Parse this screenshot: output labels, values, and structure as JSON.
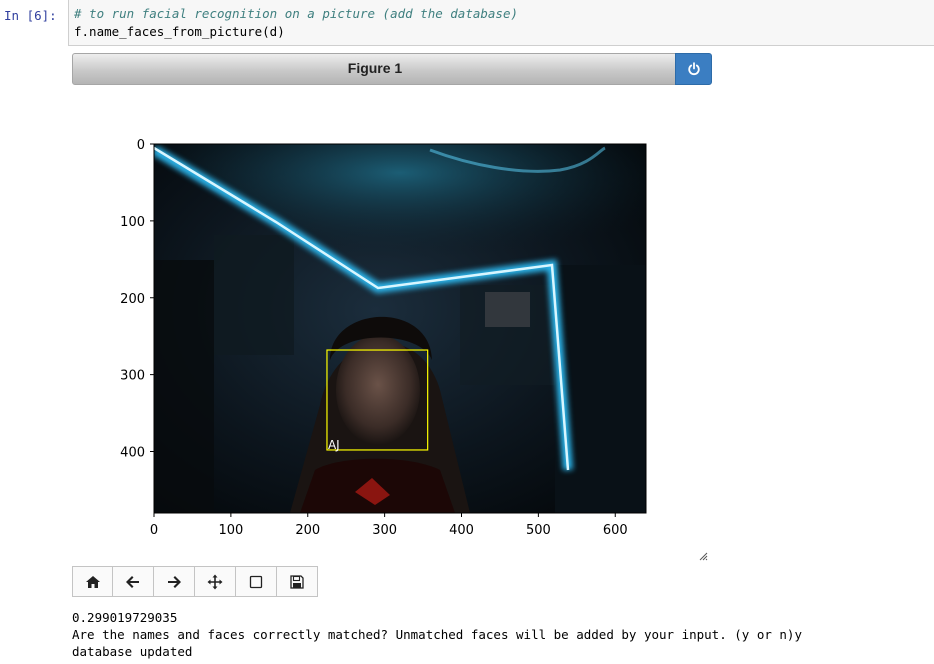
{
  "cell": {
    "prompt": "In [6]:",
    "code_comment": "# to run facial recognition on a picture (add the database)",
    "code_call": "f.name_faces_from_picture(d)"
  },
  "figure": {
    "title": "Figure 1",
    "power_icon": "power-icon"
  },
  "chart_data": {
    "type": "image",
    "x_ticks": [
      "0",
      "100",
      "200",
      "300",
      "400",
      "500",
      "600"
    ],
    "y_ticks": [
      "0",
      "100",
      "200",
      "300",
      "400"
    ],
    "xlim": [
      0,
      640
    ],
    "ylim": [
      480,
      0
    ],
    "face_box": {
      "label": "AJ",
      "x0": 225,
      "y0": 268,
      "x1": 356,
      "y1": 398,
      "color": "#ffff00"
    }
  },
  "toolbar": {
    "buttons": [
      "home-icon",
      "back-arrow-icon",
      "forward-arrow-icon",
      "move-icon",
      "zoom-rect-icon",
      "save-icon"
    ]
  },
  "output": {
    "line1": "0.299019729035",
    "line2": "Are the names and faces correctly matched? Unmatched faces will be added by your input. (y or n)y",
    "line3": "database updated"
  }
}
